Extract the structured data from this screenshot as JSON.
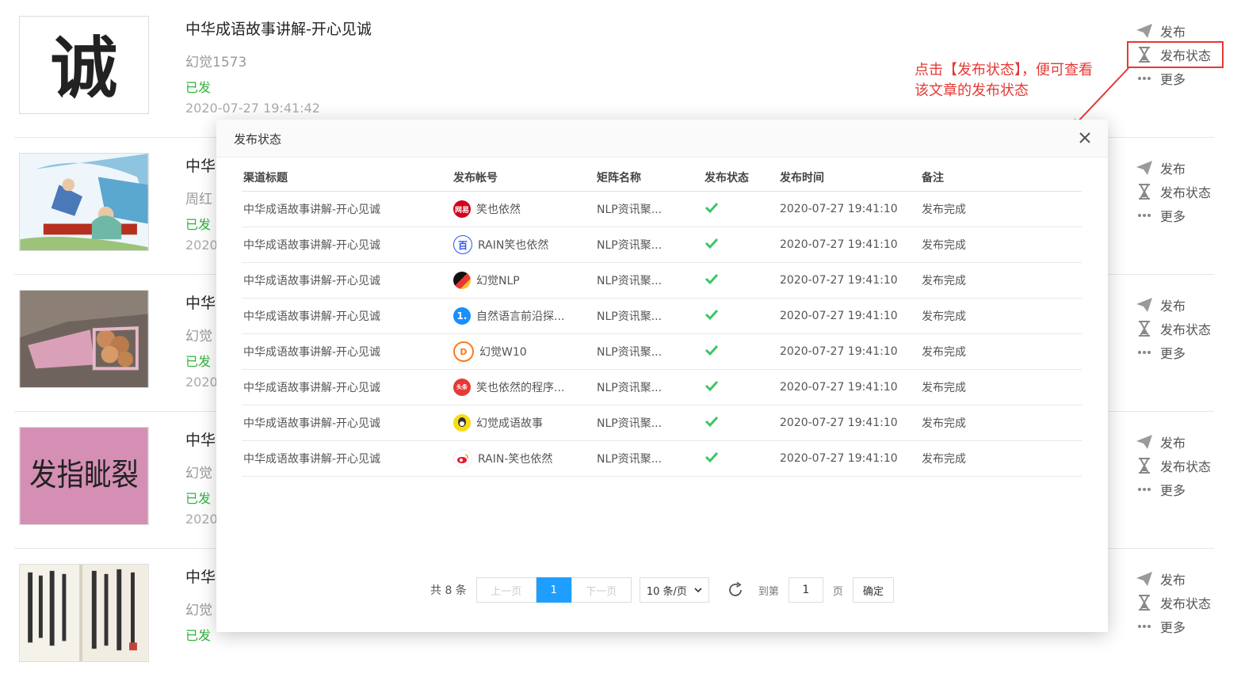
{
  "articles": [
    {
      "title": "中华成语故事讲解-开心见诚",
      "author": "幻觉1573",
      "status": "已发",
      "time": "2020-07-27 19:41:42",
      "thumb_text": "诚"
    },
    {
      "title": "中华",
      "author": "周红",
      "status": "已发",
      "time": "2020-"
    },
    {
      "title": "中华",
      "author": "幻觉",
      "status": "已发",
      "time": "2020-"
    },
    {
      "title": "中华",
      "author": "幻觉",
      "status": "已发",
      "time": "2020-",
      "thumb_text": "发指眦裂"
    },
    {
      "title": "中华",
      "author": "幻觉",
      "status": "已发",
      "time": ""
    }
  ],
  "actions": {
    "publish": "发布",
    "publish_status": "发布状态",
    "more": "更多"
  },
  "annotation": "点击【发布状态】，便可查看该文章的发布状态",
  "modal": {
    "title": "发布状态",
    "columns": [
      "渠道标题",
      "发布帐号",
      "矩阵名称",
      "发布状态",
      "发布时间",
      "备注"
    ],
    "rows": [
      {
        "channel_title": "中华成语故事讲解-开心见诚",
        "account": "笑也依然",
        "platform_icon": "netease-icon",
        "matrix": "NLP资讯聚...",
        "time": "2020-07-27 19:41:10",
        "note": "发布完成"
      },
      {
        "channel_title": "中华成语故事讲解-开心见诚",
        "account": "RAIN笑也依然",
        "platform_icon": "baidu-icon",
        "matrix": "NLP资讯聚...",
        "time": "2020-07-27 19:41:10",
        "note": "发布完成"
      },
      {
        "channel_title": "中华成语故事讲解-开心见诚",
        "account": "幻觉NLP",
        "platform_icon": "sohu-icon",
        "matrix": "NLP资讯聚...",
        "time": "2020-07-27 19:41:10",
        "note": "发布完成"
      },
      {
        "channel_title": "中华成语故事讲解-开心见诚",
        "account": "自然语言前沿探...",
        "platform_icon": "yidian-icon",
        "matrix": "NLP资讯聚...",
        "time": "2020-07-27 19:41:10",
        "note": "发布完成"
      },
      {
        "channel_title": "中华成语故事讲解-开心见诚",
        "account": "幻觉W10",
        "platform_icon": "dayu-icon",
        "matrix": "NLP资讯聚...",
        "time": "2020-07-27 19:41:10",
        "note": "发布完成"
      },
      {
        "channel_title": "中华成语故事讲解-开心见诚",
        "account": "笑也依然的程序...",
        "platform_icon": "toutiao-icon",
        "matrix": "NLP资讯聚...",
        "time": "2020-07-27 19:41:10",
        "note": "发布完成"
      },
      {
        "channel_title": "中华成语故事讲解-开心见诚",
        "account": "幻觉成语故事",
        "platform_icon": "qq-icon",
        "matrix": "NLP资讯聚...",
        "time": "2020-07-27 19:41:10",
        "note": "发布完成"
      },
      {
        "channel_title": "中华成语故事讲解-开心见诚",
        "account": "RAIN-笑也依然",
        "platform_icon": "weibo-icon",
        "matrix": "NLP资讯聚...",
        "time": "2020-07-27 19:41:10",
        "note": "发布完成"
      }
    ],
    "pager": {
      "total": "共 8 条",
      "prev": "上一页",
      "current": "1",
      "next": "下一页",
      "size": "10 条/页",
      "goto_label": "到第",
      "goto_value": "1",
      "page_unit": "页",
      "confirm": "确定"
    }
  },
  "colors": {
    "accent": "#1e9fff",
    "success": "#31b23b",
    "annotation": "#e53935"
  }
}
